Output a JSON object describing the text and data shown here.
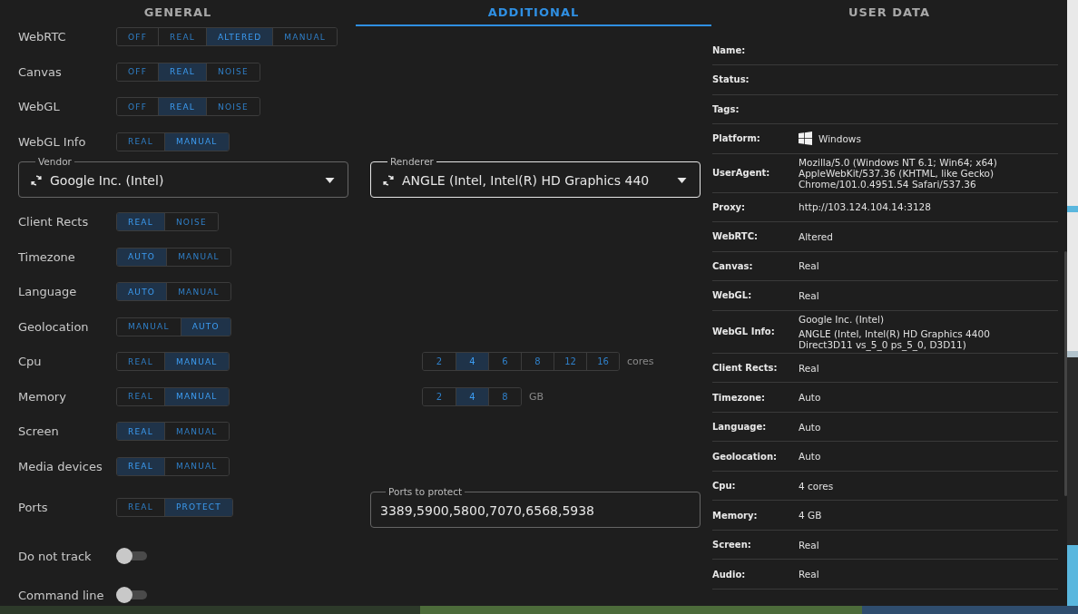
{
  "tabs": [
    {
      "label": "GENERAL",
      "selected": false
    },
    {
      "label": "ADDITIONAL",
      "selected": true
    },
    {
      "label": "USER DATA",
      "selected": false
    }
  ],
  "settings": [
    {
      "kind": "segmented",
      "label": "WebRTC",
      "options": [
        {
          "label": "OFF",
          "selected": false
        },
        {
          "label": "REAL",
          "selected": false
        },
        {
          "label": "ALTERED",
          "selected": true
        },
        {
          "label": "MANUAL",
          "selected": false
        }
      ]
    },
    {
      "kind": "segmented",
      "label": "Canvas",
      "options": [
        {
          "label": "OFF",
          "selected": false
        },
        {
          "label": "REAL",
          "selected": true
        },
        {
          "label": "NOISE",
          "selected": false
        }
      ]
    },
    {
      "kind": "segmented",
      "label": "WebGL",
      "options": [
        {
          "label": "OFF",
          "selected": false
        },
        {
          "label": "REAL",
          "selected": true
        },
        {
          "label": "NOISE",
          "selected": false
        }
      ]
    },
    {
      "kind": "segmented",
      "label": "WebGL Info",
      "options": [
        {
          "label": "REAL",
          "selected": false
        },
        {
          "label": "MANUAL",
          "selected": true
        }
      ]
    },
    {
      "kind": "selects",
      "selects": [
        {
          "label": "Vendor",
          "value": "Google Inc. (Intel)",
          "focused": false
        },
        {
          "label": "Renderer",
          "value": "ANGLE (Intel, Intel(R) HD Graphics 440",
          "focused": true
        }
      ]
    },
    {
      "kind": "segmented",
      "label": "Client Rects",
      "options": [
        {
          "label": "REAL",
          "selected": true
        },
        {
          "label": "NOISE",
          "selected": false
        }
      ]
    },
    {
      "kind": "segmented",
      "label": "Timezone",
      "options": [
        {
          "label": "AUTO",
          "selected": true
        },
        {
          "label": "MANUAL",
          "selected": false
        }
      ]
    },
    {
      "kind": "segmented",
      "label": "Language",
      "options": [
        {
          "label": "AUTO",
          "selected": true
        },
        {
          "label": "MANUAL",
          "selected": false
        }
      ]
    },
    {
      "kind": "segmented",
      "label": "Geolocation",
      "options": [
        {
          "label": "MANUAL",
          "selected": false
        },
        {
          "label": "AUTO",
          "selected": true
        }
      ]
    },
    {
      "kind": "segmented",
      "label": "Cpu",
      "options": [
        {
          "label": "REAL",
          "selected": false
        },
        {
          "label": "MANUAL",
          "selected": true
        }
      ],
      "extra": {
        "kind": "numbers",
        "unit": "cores",
        "options": [
          {
            "label": "2",
            "selected": false
          },
          {
            "label": "4",
            "selected": true
          },
          {
            "label": "6",
            "selected": false
          },
          {
            "label": "8",
            "selected": false
          },
          {
            "label": "12",
            "selected": false
          },
          {
            "label": "16",
            "selected": false
          }
        ]
      }
    },
    {
      "kind": "segmented",
      "label": "Memory",
      "options": [
        {
          "label": "REAL",
          "selected": false
        },
        {
          "label": "MANUAL",
          "selected": true
        }
      ],
      "extra": {
        "kind": "numbers",
        "unit": "GB",
        "options": [
          {
            "label": "2",
            "selected": false
          },
          {
            "label": "4",
            "selected": true
          },
          {
            "label": "8",
            "selected": false
          }
        ]
      }
    },
    {
      "kind": "segmented",
      "label": "Screen",
      "options": [
        {
          "label": "REAL",
          "selected": true
        },
        {
          "label": "MANUAL",
          "selected": false
        }
      ]
    },
    {
      "kind": "segmented",
      "label": "Media devices",
      "options": [
        {
          "label": "REAL",
          "selected": true
        },
        {
          "label": "MANUAL",
          "selected": false
        }
      ]
    },
    {
      "kind": "segmented",
      "label": "Ports",
      "options": [
        {
          "label": "REAL",
          "selected": false
        },
        {
          "label": "PROTECT",
          "selected": true
        }
      ],
      "extra": {
        "kind": "field",
        "label": "Ports to protect",
        "value": "3389,5900,5800,7070,6568,5938"
      }
    },
    {
      "kind": "toggle",
      "label": "Do not track",
      "on": false
    },
    {
      "kind": "toggle",
      "label": "Command line",
      "on": false
    }
  ],
  "user_data": [
    {
      "label": "Name:"
    },
    {
      "label": "Status:"
    },
    {
      "label": "Tags:"
    },
    {
      "kind": "platform",
      "label": "Platform:",
      "values": [
        "Windows"
      ]
    },
    {
      "kind": "text",
      "label": "UserAgent:",
      "values": [
        "Mozilla/5.0 (Windows NT 6.1; Win64; x64) AppleWebKit/537.36 (KHTML, like Gecko) Chrome/101.0.4951.54 Safari/537.36"
      ]
    },
    {
      "kind": "text",
      "label": "Proxy:",
      "values": [
        "http://103.124.104.14:3128"
      ]
    },
    {
      "kind": "text",
      "label": "WebRTC:",
      "values": [
        "Altered"
      ]
    },
    {
      "kind": "text",
      "label": "Canvas:",
      "values": [
        "Real"
      ]
    },
    {
      "kind": "text",
      "label": "WebGL:",
      "values": [
        "Real"
      ]
    },
    {
      "kind": "text",
      "label": "WebGL Info:",
      "values": [
        "Google Inc. (Intel)",
        "ANGLE (Intel, Intel(R) HD Graphics 4400 Direct3D11 vs_5_0 ps_5_0, D3D11)"
      ]
    },
    {
      "kind": "text",
      "label": "Client Rects:",
      "values": [
        "Real"
      ]
    },
    {
      "kind": "text",
      "label": "Timezone:",
      "values": [
        "Auto"
      ]
    },
    {
      "kind": "text",
      "label": "Language:",
      "values": [
        "Auto"
      ]
    },
    {
      "kind": "text",
      "label": "Geolocation:",
      "values": [
        "Auto"
      ]
    },
    {
      "kind": "text",
      "label": "Cpu:",
      "values": [
        "4 cores"
      ]
    },
    {
      "kind": "text",
      "label": "Memory:",
      "values": [
        "4 GB"
      ]
    },
    {
      "kind": "text",
      "label": "Screen:",
      "values": [
        "Real"
      ]
    },
    {
      "kind": "text",
      "label": "Audio:",
      "values": [
        "Real"
      ]
    }
  ]
}
